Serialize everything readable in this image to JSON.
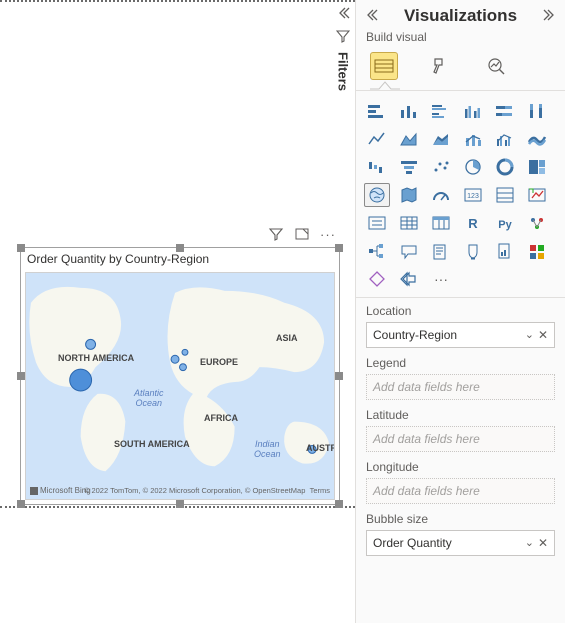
{
  "filters_tab_label": "Filters",
  "visual": {
    "title": "Order Quantity by Country-Region",
    "map_labels": {
      "north_america": "NORTH AMERICA",
      "europe": "EUROPE",
      "asia": "ASIA",
      "africa": "AFRICA",
      "south_america": "SOUTH AMERICA",
      "indian_ocean": "Indian\nOcean",
      "atlantic_ocean": "Atlantic\nOcean",
      "austr": "AUSTR…"
    },
    "attribution_brand": "Microsoft Bing",
    "attribution_text": "© 2022 TomTom, © 2022 Microsoft Corporation,",
    "attribution_link1": "© OpenStreetMap",
    "attribution_link2": "Terms"
  },
  "panel": {
    "title": "Visualizations",
    "subtitle": "Build visual",
    "wells": {
      "location": {
        "label": "Location",
        "value": "Country-Region"
      },
      "legend": {
        "label": "Legend",
        "placeholder": "Add data fields here"
      },
      "latitude": {
        "label": "Latitude",
        "placeholder": "Add data fields here"
      },
      "longitude": {
        "label": "Longitude",
        "placeholder": "Add data fields here"
      },
      "bubble": {
        "label": "Bubble size",
        "value": "Order Quantity"
      }
    }
  }
}
